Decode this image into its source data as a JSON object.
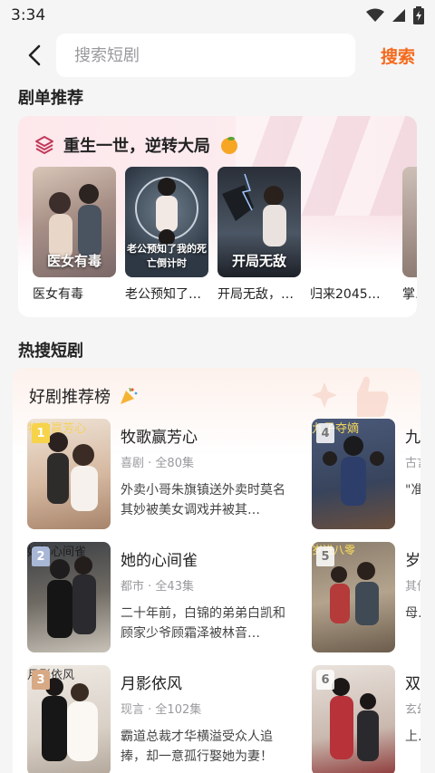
{
  "status": {
    "time": "3:34"
  },
  "search": {
    "placeholder": "搜索短剧",
    "submit_label": "搜索"
  },
  "playlist_section": {
    "title": "剧单推荐",
    "card_title": "重生一世，逆转大局",
    "dramas": [
      {
        "title": "医女有毒",
        "poster_text": "医女有毒"
      },
      {
        "title": "老公预知了…",
        "poster_text": "老公预知了我的死亡倒计时"
      },
      {
        "title": "开局无敌，…",
        "poster_text": "开局无敌"
      },
      {
        "title": "归来2045…",
        "poster_text": ""
      },
      {
        "title": "掌…",
        "poster_text": ""
      }
    ]
  },
  "hot_section": {
    "title": "热搜短剧",
    "ranking_title": "好剧推荐榜",
    "items": [
      {
        "rank": "1",
        "title": "牧歌赢芳心",
        "genre": "喜剧",
        "episodes": "全80集",
        "desc": "外卖小哥朱旗镇送外卖时莫名其妙被美女调戏并被其…",
        "poster_text": "牧歌赢芳心"
      },
      {
        "rank": "2",
        "title": "她的心间雀",
        "genre": "都市",
        "episodes": "全43集",
        "desc": "二十年前，白锦的弟弟白凯和顾家少爷顾霜泽被林音…",
        "poster_text": "她的心间雀"
      },
      {
        "rank": "3",
        "title": "月影依风",
        "genre": "现言",
        "episodes": "全102集",
        "desc": "霸道总裁才华横溢受众人追捧，却一意孤行娶她为妻！",
        "poster_text": "月影依风"
      },
      {
        "rank": "4",
        "title": "九…",
        "genre": "古言",
        "episodes": "",
        "desc": "\"准…帝\"",
        "poster_text": "九子夺嫡"
      },
      {
        "rank": "5",
        "title": "岁…",
        "genre": "其他",
        "episodes": "",
        "desc": "母…室…",
        "poster_text": "岁进八零"
      },
      {
        "rank": "6",
        "title": "双…",
        "genre": "玄幻",
        "episodes": "",
        "desc": "上…恶…",
        "poster_text": ""
      }
    ]
  },
  "colors": {
    "accent": "#f46a1c",
    "background": "#f5f5f6"
  }
}
